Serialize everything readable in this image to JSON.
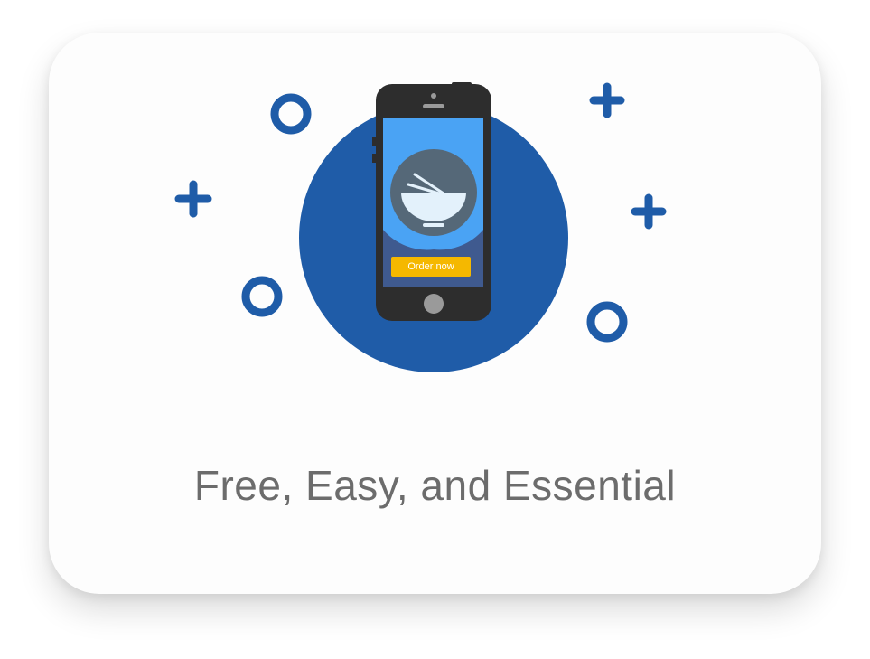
{
  "card": {
    "title": "Free, Easy, and Essential",
    "order_button_label": "Order now"
  },
  "illustration": {
    "subject": "smartphone with food bowl ordering screen",
    "icons": [
      "plus-icon",
      "ring-icon",
      "bowl-icon",
      "chopsticks-icon"
    ]
  },
  "colors": {
    "primary_blue": "#1f5ca8",
    "screen_blue": "#4aa3f4",
    "phone_body": "#2d2d2d",
    "bowl_backdrop": "#556878",
    "bowl": "#e3f1fb",
    "button_yellow": "#f5b800",
    "title_gray": "#6c6c6c"
  }
}
